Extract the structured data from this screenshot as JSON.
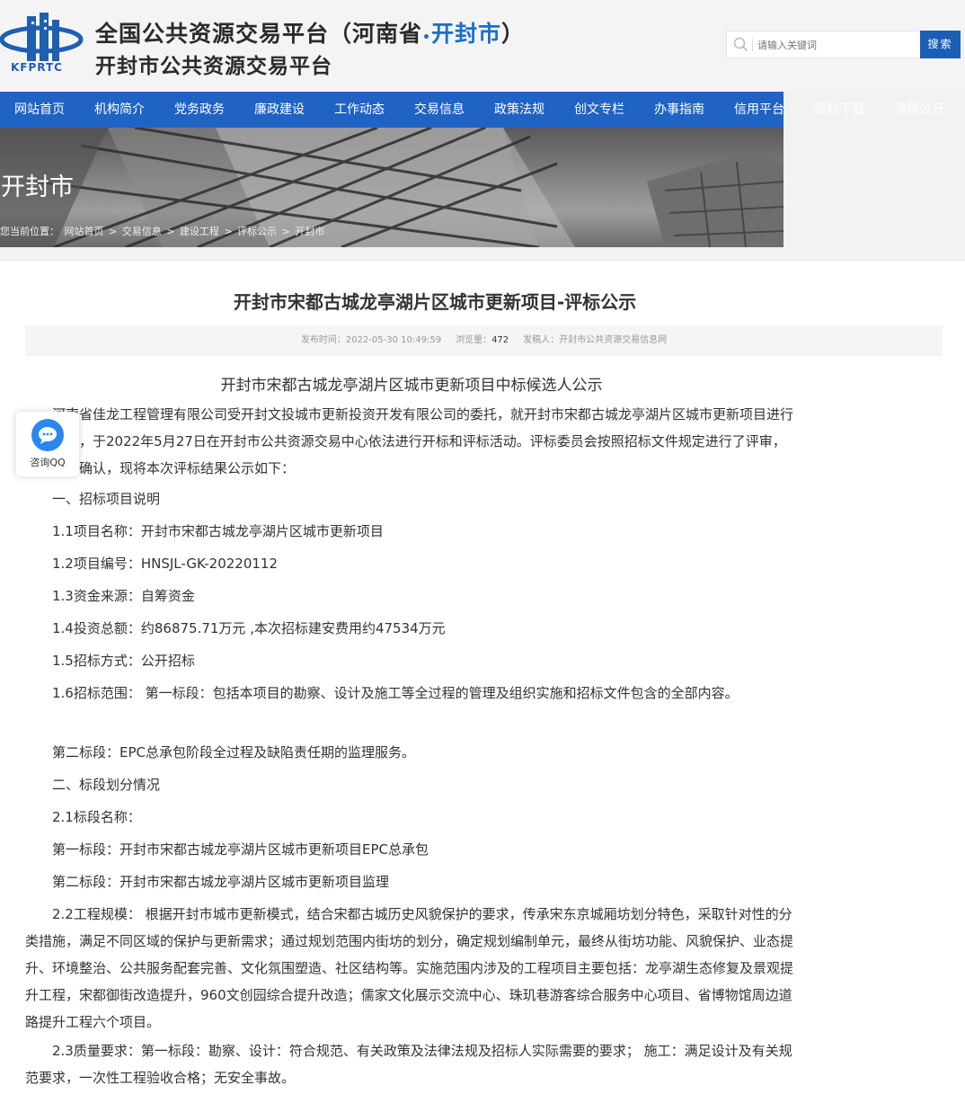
{
  "header": {
    "logo_text": "KFPRTC",
    "title_main_prefix": "全国公共资源交易平台（河南省",
    "title_dot": "•",
    "title_city": "开封市",
    "title_main_suffix": "）",
    "title_sub": "开封市公共资源交易平台",
    "search_placeholder": "请输入关键词",
    "search_button": "搜索"
  },
  "nav": {
    "items": [
      "网站首页",
      "机构简介",
      "党务政务",
      "廉政建设",
      "工作动态",
      "交易信息",
      "政策法规",
      "创文专栏",
      "办事指南",
      "信用平台"
    ],
    "ghost_items": [
      "资料下载",
      "流程公开"
    ]
  },
  "banner": {
    "title": "开封市",
    "breadcrumb": [
      "您当前位置：",
      "网站首页",
      ">",
      "交易信息",
      ">",
      "建设工程",
      ">",
      "评标公示",
      ">",
      "开封市"
    ]
  },
  "article": {
    "title": "开封市宋都古城龙亭湖片区城市更新项目-评标公示",
    "meta_time_label": "发布时间：",
    "meta_time": "2022-05-30 10:49:59",
    "meta_views_label": "浏览量：",
    "meta_views": "472",
    "meta_source_label": "发稿人：",
    "meta_source": "开封市公共资源交易信息网",
    "sub_title": "开封市宋都古城龙亭湖片区城市更新项目中标候选人公示",
    "paragraphs": [
      "　　河南省佳龙工程管理有限公司受开封文投城市更新投资开发有限公司的委托，就开封市宋都古城龙亭湖片区城市更新项目进行公开招标，于2022年5月27日在开封市公共资源交易中心依法进行开标和评标活动。评标委员会按照招标文件规定进行了评审，经招标人确认，现将本次评标结果公示如下：",
      "　　一、招标项目说明",
      "　　1.1项目名称：开封市宋都古城龙亭湖片区城市更新项目",
      "　　1.2项目编号：HNSJL-GK-20220112",
      "　　1.3资金来源：自筹资金",
      "　　1.4投资总额：约86875.71万元 ,本次招标建安费用约47534万元",
      "　　1.5招标方式：公开招标",
      "　　1.6招标范围： 第一标段：包括本项目的勘察、设计及施工等全过程的管理及组织实施和招标文件包含的全部内容。",
      "　　第二标段：EPC总承包阶段全过程及缺陷责任期的监理服务。",
      "　　二、标段划分情况",
      "　　2.1标段名称：",
      "　　第一标段：开封市宋都古城龙亭湖片区城市更新项目EPC总承包",
      "　　第二标段：开封市宋都古城龙亭湖片区城市更新项目监理",
      "　　2.2工程规模： 根据开封市城市更新模式，结合宋都古城历史风貌保护的要求，传承宋东京城厢坊划分特色，采取针对性的分类措施，满足不同区域的保护与更新需求；通过规划范围内街坊的划分，确定规划编制单元，最终从街坊功能、风貌保护、业态提升、环境整治、公共服务配套完善、文化氛围塑造、社区结构等。实施范围内涉及的工程项目主要包括：龙亭湖生态修复及景观提升工程，宋都御街改造提升，960文创园综合提升改造；儒家文化展示交流中心、珠玑巷游客综合服务中心项目、省博物馆周边道路提升工程六个项目。",
      "　　2.3质量要求：第一标段：勘察、设计：符合规范、有关政策及法律法规及招标人实际需要的要求； 施工：满足设计及有关规范要求，一次性工程验收合格；无安全事故。"
    ]
  },
  "float": {
    "qq_label": "咨询QQ"
  },
  "colors": {
    "brand_blue": "#1f63c4",
    "search_button": "#1a5fb4"
  }
}
